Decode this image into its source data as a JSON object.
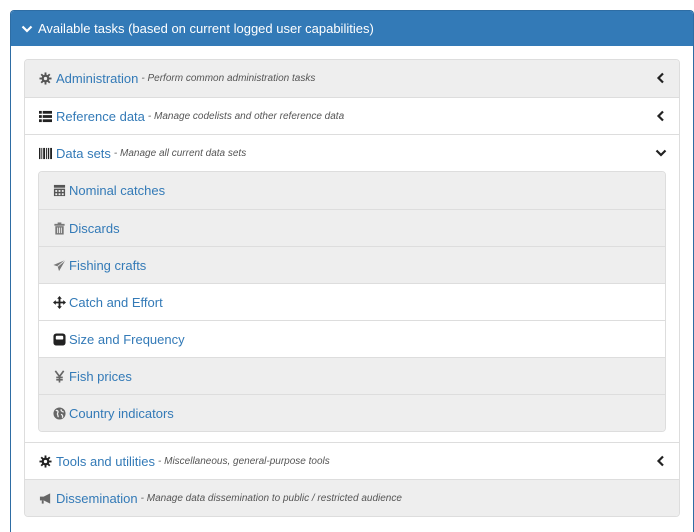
{
  "header": {
    "title": "Available tasks (based on current logged user capabilities)"
  },
  "tasks": [
    {
      "title": "Administration",
      "desc": "- Perform common administration tasks",
      "icon": "cog-icon"
    },
    {
      "title": "Reference data",
      "desc": "- Manage codelists and other reference data",
      "icon": "list-icon"
    },
    {
      "title": "Data sets",
      "desc": "- Manage all current data sets",
      "icon": "barcode-icon"
    },
    {
      "title": "Tools and utilities",
      "desc": "- Miscellaneous, general-purpose tools",
      "icon": "cog-icon"
    },
    {
      "title": "Dissemination",
      "desc": "- Manage data dissemination to public / restricted audience",
      "icon": "bullhorn-icon"
    }
  ],
  "datasets": [
    {
      "label": "Nominal catches",
      "icon": "calendar-icon"
    },
    {
      "label": "Discards",
      "icon": "trash-icon"
    },
    {
      "label": "Fishing crafts",
      "icon": "send-icon"
    },
    {
      "label": "Catch and Effort",
      "icon": "move-icon"
    },
    {
      "label": "Size and Frequency",
      "icon": "scale-icon"
    },
    {
      "label": "Fish prices",
      "icon": "yen-icon"
    },
    {
      "label": "Country indicators",
      "icon": "globe-icon"
    }
  ]
}
